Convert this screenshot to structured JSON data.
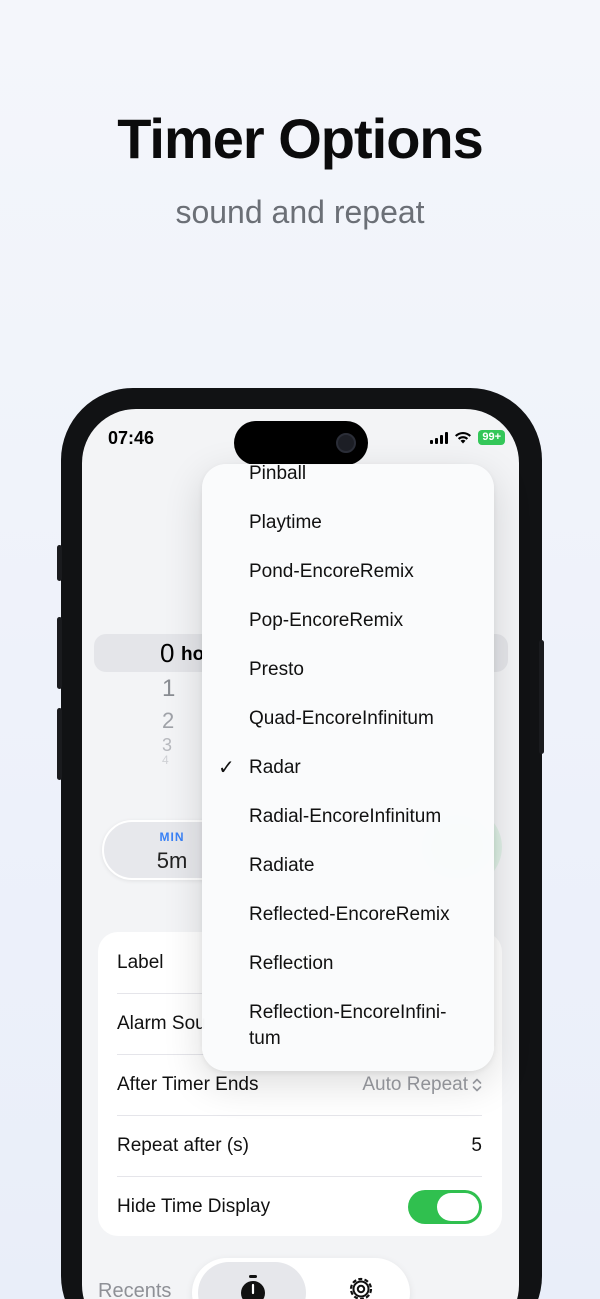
{
  "headline": "Timer Options",
  "subhead": "sound and repeat",
  "status": {
    "time": "07:46",
    "battery": "99+"
  },
  "picker": {
    "selected_value": "0",
    "unit": "ho",
    "below": [
      "1",
      "2",
      "3",
      "4"
    ]
  },
  "duration_chip": {
    "caption": "MIN",
    "value": "5m"
  },
  "settings": {
    "label_row": "Label",
    "alarm_row": "Alarm Sou",
    "after_timer_label": "After Timer Ends",
    "after_timer_value": "Auto Repeat",
    "repeat_label": "Repeat after (s)",
    "repeat_value": "5",
    "hide_label": "Hide Time Display",
    "hide_enabled": true
  },
  "recents_label": "Recents",
  "sound_menu": {
    "selected": "Radar",
    "items": [
      "Pinball",
      "Playtime",
      "Pond-EncoreRemix",
      "Pop-EncoreRemix",
      "Presto",
      "Quad-EncoreInfinitum",
      "Radar",
      "Radial-EncoreInfinitum",
      "Radiate",
      "Reflected-EncoreRemix",
      "Reflection",
      "Reflection-EncoreInfini-",
      "tum"
    ]
  },
  "icons": {
    "check": "checkmark-icon",
    "chevron": "up-down-chevron-icon",
    "tab_timer": "stopwatch-icon",
    "tab_settings": "gear-icon"
  },
  "colors": {
    "accent_green": "#30c04f",
    "accent_blue": "#3b82f6"
  }
}
